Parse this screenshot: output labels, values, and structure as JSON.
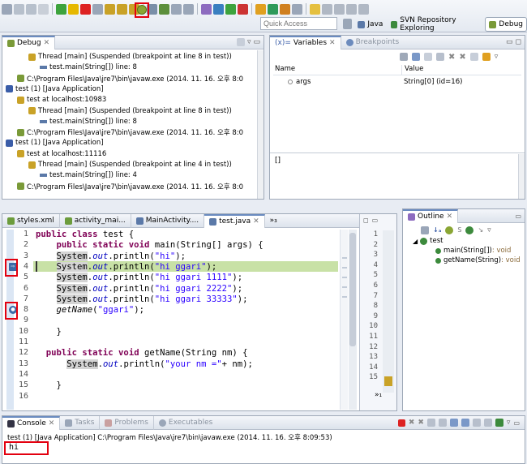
{
  "toolbar": {
    "quick_access_placeholder": "Quick Access",
    "perspectives": [
      {
        "label": "Java"
      },
      {
        "label": "SVN Repository Exploring"
      },
      {
        "label": "Debug"
      }
    ]
  },
  "debug_view": {
    "tab_label": "Debug",
    "rows": [
      {
        "text": "Thread [main] (Suspended (breakpoint at line 8 in test))",
        "icon": "thread-icon"
      },
      {
        "text": "test.main(String[]) line: 8",
        "icon": "stack-frame-icon"
      },
      {
        "text": "C:\\Program Files\\Java\\jre7\\bin\\javaw.exe (2014. 11. 16. 오후 8:0",
        "icon": "process-icon"
      },
      {
        "text": "test (1) [Java Application]",
        "icon": "launch-icon"
      },
      {
        "text": "test at localhost:10983",
        "icon": "debug-target-icon"
      },
      {
        "text": "Thread [main] (Suspended (breakpoint at line 8 in test))",
        "icon": "thread-icon"
      },
      {
        "text": "test.main(String[]) line: 8",
        "icon": "stack-frame-icon"
      },
      {
        "text": "C:\\Program Files\\Java\\jre7\\bin\\javaw.exe (2014. 11. 16. 오후 8:0",
        "icon": "process-icon"
      },
      {
        "text": "test (1) [Java Application]",
        "icon": "launch-icon"
      },
      {
        "text": "test at localhost:11116",
        "icon": "debug-target-icon"
      },
      {
        "text": "Thread [main] (Suspended (breakpoint at line 4 in test))",
        "icon": "thread-icon"
      },
      {
        "text": "test.main(String[]) line: 4",
        "icon": "stack-frame-icon"
      },
      {
        "text": "C:\\Program Files\\Java\\jre7\\bin\\javaw.exe (2014. 11. 16. 오후 8:0",
        "icon": "process-icon"
      }
    ]
  },
  "variables_view": {
    "tab_label": "Variables",
    "tab2_label": "Breakpoints",
    "col_name": "Name",
    "col_value": "Value",
    "rows": [
      {
        "name": "args",
        "value": "String[0]  (id=16)"
      }
    ],
    "detail_text": "[]"
  },
  "editor": {
    "tabs": [
      {
        "label": "styles.xml"
      },
      {
        "label": "activity_mai..."
      },
      {
        "label": "MainActivity...."
      },
      {
        "label": "test.java"
      },
      {
        "label": "»₃"
      }
    ],
    "line_numbers": [
      "1",
      "2",
      "3",
      "4",
      "5",
      "6",
      "7",
      "8",
      "9",
      "10",
      "11",
      "12",
      "13",
      "14",
      "15",
      "16"
    ],
    "lines": [
      [
        {
          "t": "public class ",
          "c": "kw"
        },
        {
          "t": "test {",
          "c": ""
        }
      ],
      [
        {
          "t": "    ",
          "c": ""
        },
        {
          "t": "public static void ",
          "c": "kw"
        },
        {
          "t": "main(String[] args) {",
          "c": ""
        }
      ],
      [
        {
          "t": "    ",
          "c": ""
        },
        {
          "t": "System",
          "c": "hl-occ"
        },
        {
          "t": ".",
          "c": ""
        },
        {
          "t": "out",
          "c": "fld"
        },
        {
          "t": ".println(",
          "c": ""
        },
        {
          "t": "\"hi\"",
          "c": "str"
        },
        {
          "t": ");",
          "c": ""
        }
      ],
      [
        {
          "t": "    ",
          "c": ""
        },
        {
          "t": "System",
          "c": "hl-occ"
        },
        {
          "t": ".",
          "c": ""
        },
        {
          "t": "out",
          "c": "fld"
        },
        {
          "t": ".println(",
          "c": ""
        },
        {
          "t": "\"hi ggari\"",
          "c": "str"
        },
        {
          "t": ");",
          "c": ""
        }
      ],
      [
        {
          "t": "    ",
          "c": ""
        },
        {
          "t": "System",
          "c": "hl-occ"
        },
        {
          "t": ".",
          "c": ""
        },
        {
          "t": "out",
          "c": "fld"
        },
        {
          "t": ".println(",
          "c": ""
        },
        {
          "t": "\"hi ggari 1111\"",
          "c": "str"
        },
        {
          "t": ");",
          "c": ""
        }
      ],
      [
        {
          "t": "    ",
          "c": ""
        },
        {
          "t": "System",
          "c": "hl-occ"
        },
        {
          "t": ".",
          "c": ""
        },
        {
          "t": "out",
          "c": "fld"
        },
        {
          "t": ".println(",
          "c": ""
        },
        {
          "t": "\"hi ggari 2222\"",
          "c": "str"
        },
        {
          "t": ");",
          "c": ""
        }
      ],
      [
        {
          "t": "    ",
          "c": ""
        },
        {
          "t": "System",
          "c": "hl-occ"
        },
        {
          "t": ".",
          "c": ""
        },
        {
          "t": "out",
          "c": "fld"
        },
        {
          "t": ".println(",
          "c": ""
        },
        {
          "t": "\"hi ggari 33333\"",
          "c": "str"
        },
        {
          "t": ");",
          "c": ""
        }
      ],
      [
        {
          "t": "    ",
          "c": ""
        },
        {
          "t": "getName",
          "c": "ital"
        },
        {
          "t": "(",
          "c": ""
        },
        {
          "t": "\"ggari\"",
          "c": "str"
        },
        {
          "t": ");",
          "c": ""
        }
      ],
      [],
      [
        {
          "t": "    }",
          "c": ""
        }
      ],
      [],
      [
        {
          "t": "  ",
          "c": ""
        },
        {
          "t": "public static void ",
          "c": "kw"
        },
        {
          "t": "getName(String nm) {",
          "c": ""
        }
      ],
      [
        {
          "t": "      ",
          "c": ""
        },
        {
          "t": "System",
          "c": "hl-occ"
        },
        {
          "t": ".",
          "c": ""
        },
        {
          "t": "out",
          "c": "fld"
        },
        {
          "t": ".println(",
          "c": ""
        },
        {
          "t": "\"your nm =\"",
          "c": "str"
        },
        {
          "t": "+ nm);",
          "c": ""
        }
      ],
      [],
      [
        {
          "t": "    }",
          "c": ""
        }
      ],
      []
    ],
    "mini_line_numbers": [
      "1",
      "2",
      "3",
      "4",
      "5",
      "6",
      "7",
      "8",
      "9",
      "10",
      "11",
      "12",
      "13",
      "14",
      "15"
    ],
    "mini_footer": "»₁"
  },
  "outline_view": {
    "tab_label": "Outline",
    "class_name": "test",
    "members": [
      {
        "name": "main(String[])",
        "type": " : void"
      },
      {
        "name": "getName(String)",
        "type": " : void"
      }
    ]
  },
  "console_view": {
    "tabs": [
      {
        "label": "Console"
      },
      {
        "label": "Tasks"
      },
      {
        "label": "Problems"
      },
      {
        "label": "Executables"
      }
    ],
    "header": "test (1) [Java Application] C:\\Program Files\\Java\\jre7\\bin\\javaw.exe (2014. 11. 16. 오후 8:09:53)",
    "output": "hi"
  },
  "colors": {
    "highlight_red": "#e3000f",
    "current_line": "#c8e1a6",
    "accent": "#6a8bc0"
  }
}
